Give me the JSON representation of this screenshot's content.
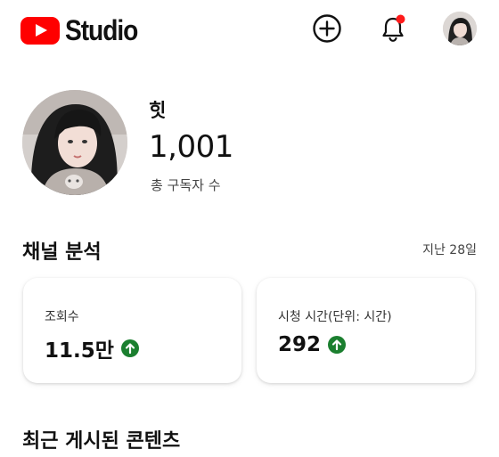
{
  "header": {
    "brand": "Studio",
    "icons": {
      "create": "add-circle-icon",
      "notifications": "bell-icon",
      "account": "account-avatar"
    },
    "brand_color": "#ff0000",
    "notification_dot_color": "#ff0000"
  },
  "channel": {
    "name": "힛",
    "subscriber_count": "1,001",
    "subscriber_label": "총 구독자 수"
  },
  "analytics": {
    "title": "채널 분석",
    "period": "지난 28일",
    "cards": [
      {
        "label": "조회수",
        "value": "11.5만",
        "trend": "up"
      },
      {
        "label": "시청 시간(단위: 시간)",
        "value": "292",
        "trend": "up"
      }
    ],
    "trend_color": "#1b7f2f"
  },
  "recent": {
    "title": "최근 게시된 콘텐츠"
  }
}
